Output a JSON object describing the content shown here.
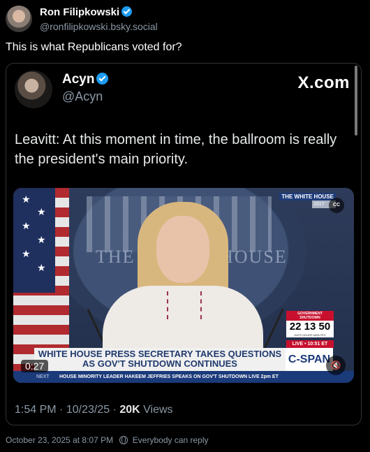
{
  "post": {
    "author_name": "Ron Filipkowski",
    "author_handle": "@ronfilipkowski.bsky.social",
    "text": "This is what Republicans voted for?",
    "timestamp": "October 23, 2025 at 8:07 PM",
    "reply_setting": "Everybody can reply"
  },
  "embed": {
    "author_name": "Acyn",
    "author_handle": "@Acyn",
    "source": "X.com",
    "text": "Leavitt: At this moment in time, the ballroom is really the president's main priority.",
    "time": "1:54 PM",
    "date": "10/23/25",
    "views_count": "20K",
    "views_label": "Views",
    "video": {
      "duration": "0:27",
      "background_text_left": "THE W",
      "background_text_right": "HOUSE",
      "network_tag": "THE WHITE HOUSE",
      "network_tag_sub": "1517",
      "cc_label": "CC",
      "shutdown_label_1": "GOVERNMENT",
      "shutdown_label_2": "SHUTDOWN",
      "shutdown_clock": "22 13 50",
      "shutdown_units": "DAYS HOURS MINUTES",
      "live_label": "LIVE • 10:51 ET",
      "headline_line1": "WHITE HOUSE PRESS SECRETARY TAKES QUESTIONS",
      "headline_line2": "AS GOV'T SHUTDOWN CONTINUES",
      "network_logo": "C-SPAN",
      "ticker_label": "NEXT",
      "ticker_text": "HOUSE MINORITY LEADER HAKEEM JEFFRIES SPEAKS ON GOV'T SHUTDOWN  LIVE 2pm ET"
    }
  },
  "icons": {
    "verified": "verified-badge-icon",
    "cc": "cc-icon",
    "mute": "mute-icon",
    "reply_setting": "globe-icon"
  },
  "colors": {
    "verified": "#1d9bf0",
    "muted_text": "#8b98a5",
    "border": "#2f3336"
  }
}
